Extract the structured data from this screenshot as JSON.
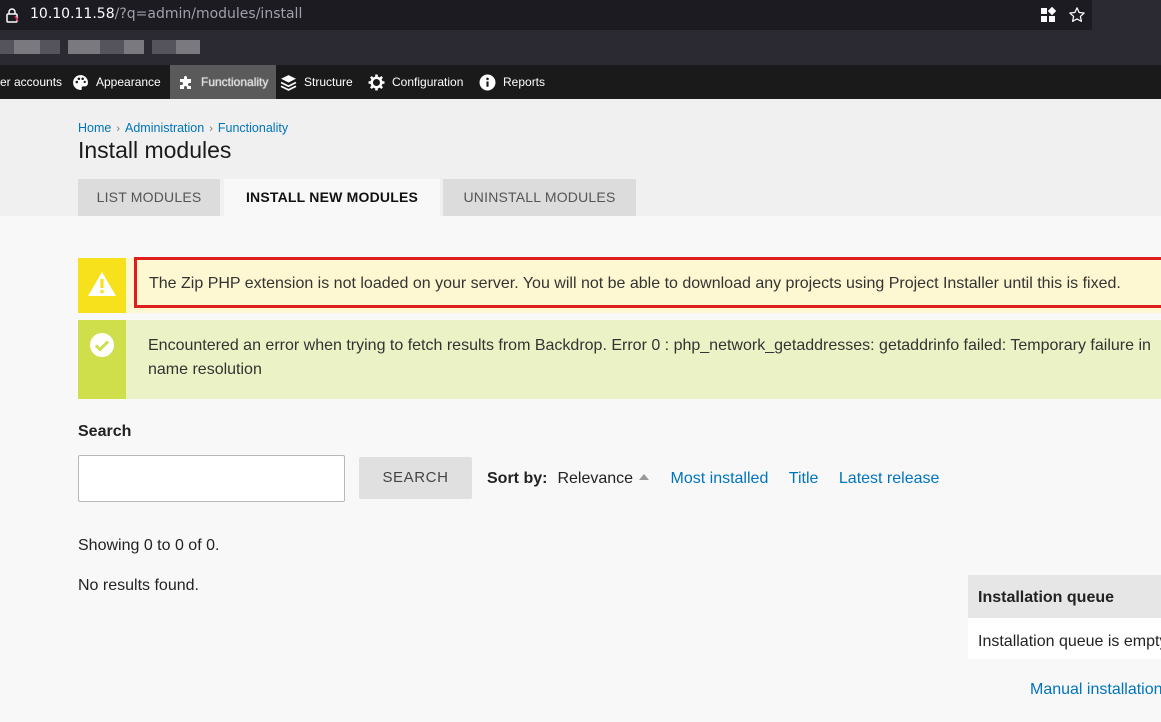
{
  "browser": {
    "url_host": "10.10.11.58",
    "url_path": "/?q=admin/modules/install"
  },
  "admin_menu": {
    "items": [
      {
        "label": "er accounts",
        "icon": "user-icon"
      },
      {
        "label": "Appearance",
        "icon": "palette-icon"
      },
      {
        "label": "Functionality",
        "icon": "puzzle-icon"
      },
      {
        "label": "Structure",
        "icon": "layers-icon"
      },
      {
        "label": "Configuration",
        "icon": "gear-icon"
      },
      {
        "label": "Reports",
        "icon": "info-icon"
      }
    ]
  },
  "breadcrumb": [
    "Home",
    "Administration",
    "Functionality"
  ],
  "page_title": "Install modules",
  "tabs": [
    {
      "label": "LIST MODULES"
    },
    {
      "label": "INSTALL NEW MODULES"
    },
    {
      "label": "UNINSTALL MODULES"
    }
  ],
  "messages": {
    "warning": "The Zip PHP extension is not loaded on your server. You will not be able to download any projects using Project Installer until this is fixed.",
    "status": "Encountered an error when trying to fetch results from Backdrop. Error 0 : php_network_getaddresses: getaddrinfo failed: Temporary failure in name resolution"
  },
  "search": {
    "label": "Search",
    "button": "SEARCH",
    "value": ""
  },
  "sort": {
    "label": "Sort by:",
    "current": "Relevance",
    "options": [
      "Most installed",
      "Title",
      "Latest release"
    ]
  },
  "results": {
    "showing": "Showing 0 to 0 of 0.",
    "empty": "No results found."
  },
  "queue": {
    "title": "Installation queue",
    "body": "Installation queue is empty.",
    "manual_link": "Manual installation"
  },
  "colors": {
    "link": "#0074bd",
    "warning_icon_bg": "#f7e01c",
    "warning_bg": "#fdf8d1",
    "warning_highlight": "#e01e1e",
    "status_icon_bg": "#cfdf4c",
    "status_bg": "#eaf2c6"
  }
}
